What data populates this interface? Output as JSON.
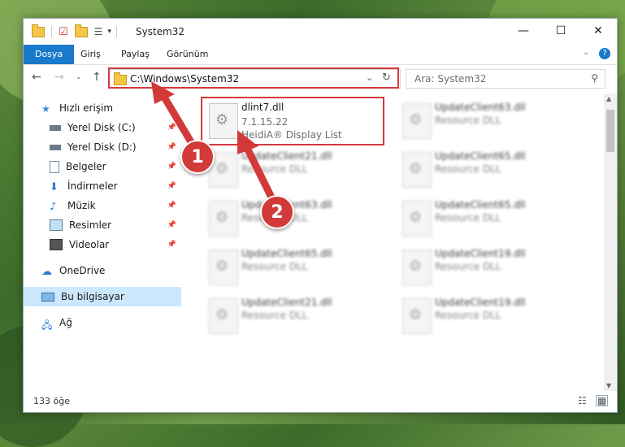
{
  "window": {
    "title": "System32"
  },
  "ribbon": {
    "tabs": [
      "Dosya",
      "Giriş",
      "Paylaş",
      "Görünüm"
    ]
  },
  "address": {
    "path": "C:\\Windows\\System32"
  },
  "search": {
    "placeholder": "Ara: System32"
  },
  "sidebar": {
    "items": [
      {
        "label": "Hızlı erişim",
        "icon": "star-icon"
      },
      {
        "label": "Yerel Disk (C:)",
        "icon": "drive-icon",
        "pinned": true
      },
      {
        "label": "Yerel Disk (D:)",
        "icon": "drive-icon",
        "pinned": true
      },
      {
        "label": "Belgeler",
        "icon": "documents-icon",
        "pinned": true
      },
      {
        "label": "İndirmeler",
        "icon": "download-icon",
        "pinned": true
      },
      {
        "label": "Müzik",
        "icon": "music-icon",
        "pinned": true
      },
      {
        "label": "Resimler",
        "icon": "pictures-icon",
        "pinned": true
      },
      {
        "label": "Videolar",
        "icon": "video-icon",
        "pinned": true
      },
      {
        "label": "OneDrive",
        "icon": "cloud-icon"
      },
      {
        "label": "Bu bilgisayar",
        "icon": "computer-icon",
        "selected": true
      },
      {
        "label": "Ağ",
        "icon": "network-icon"
      }
    ]
  },
  "files": [
    {
      "name": "dlint7.dll",
      "version": "7.1.15.22",
      "desc": "HeidiA® Display List"
    },
    {
      "name": "UpdateClient63.dll",
      "desc": "Resource DLL"
    },
    {
      "name": "UpdateClient21.dll",
      "desc": "Resource DLL"
    },
    {
      "name": "UpdateClient65.dll",
      "desc": "Resource DLL"
    },
    {
      "name": "UpdateClient63.dll",
      "desc": "Resource DLL"
    },
    {
      "name": "UpdateClient65.dll",
      "desc": "Resource DLL"
    },
    {
      "name": "UpdateClient65.dll",
      "desc": "Resource DLL"
    },
    {
      "name": "UpdateClient19.dll",
      "desc": "Resource DLL"
    },
    {
      "name": "UpdateClient21.dll",
      "desc": "Resource DLL"
    },
    {
      "name": "UpdateClient19.dll",
      "desc": "Resource DLL"
    }
  ],
  "status": {
    "count": "133 öğe"
  },
  "callouts": {
    "one": "1",
    "two": "2"
  },
  "colors": {
    "accent": "#1979ca",
    "highlight": "#d23a3a",
    "selection": "#cce8ff"
  }
}
